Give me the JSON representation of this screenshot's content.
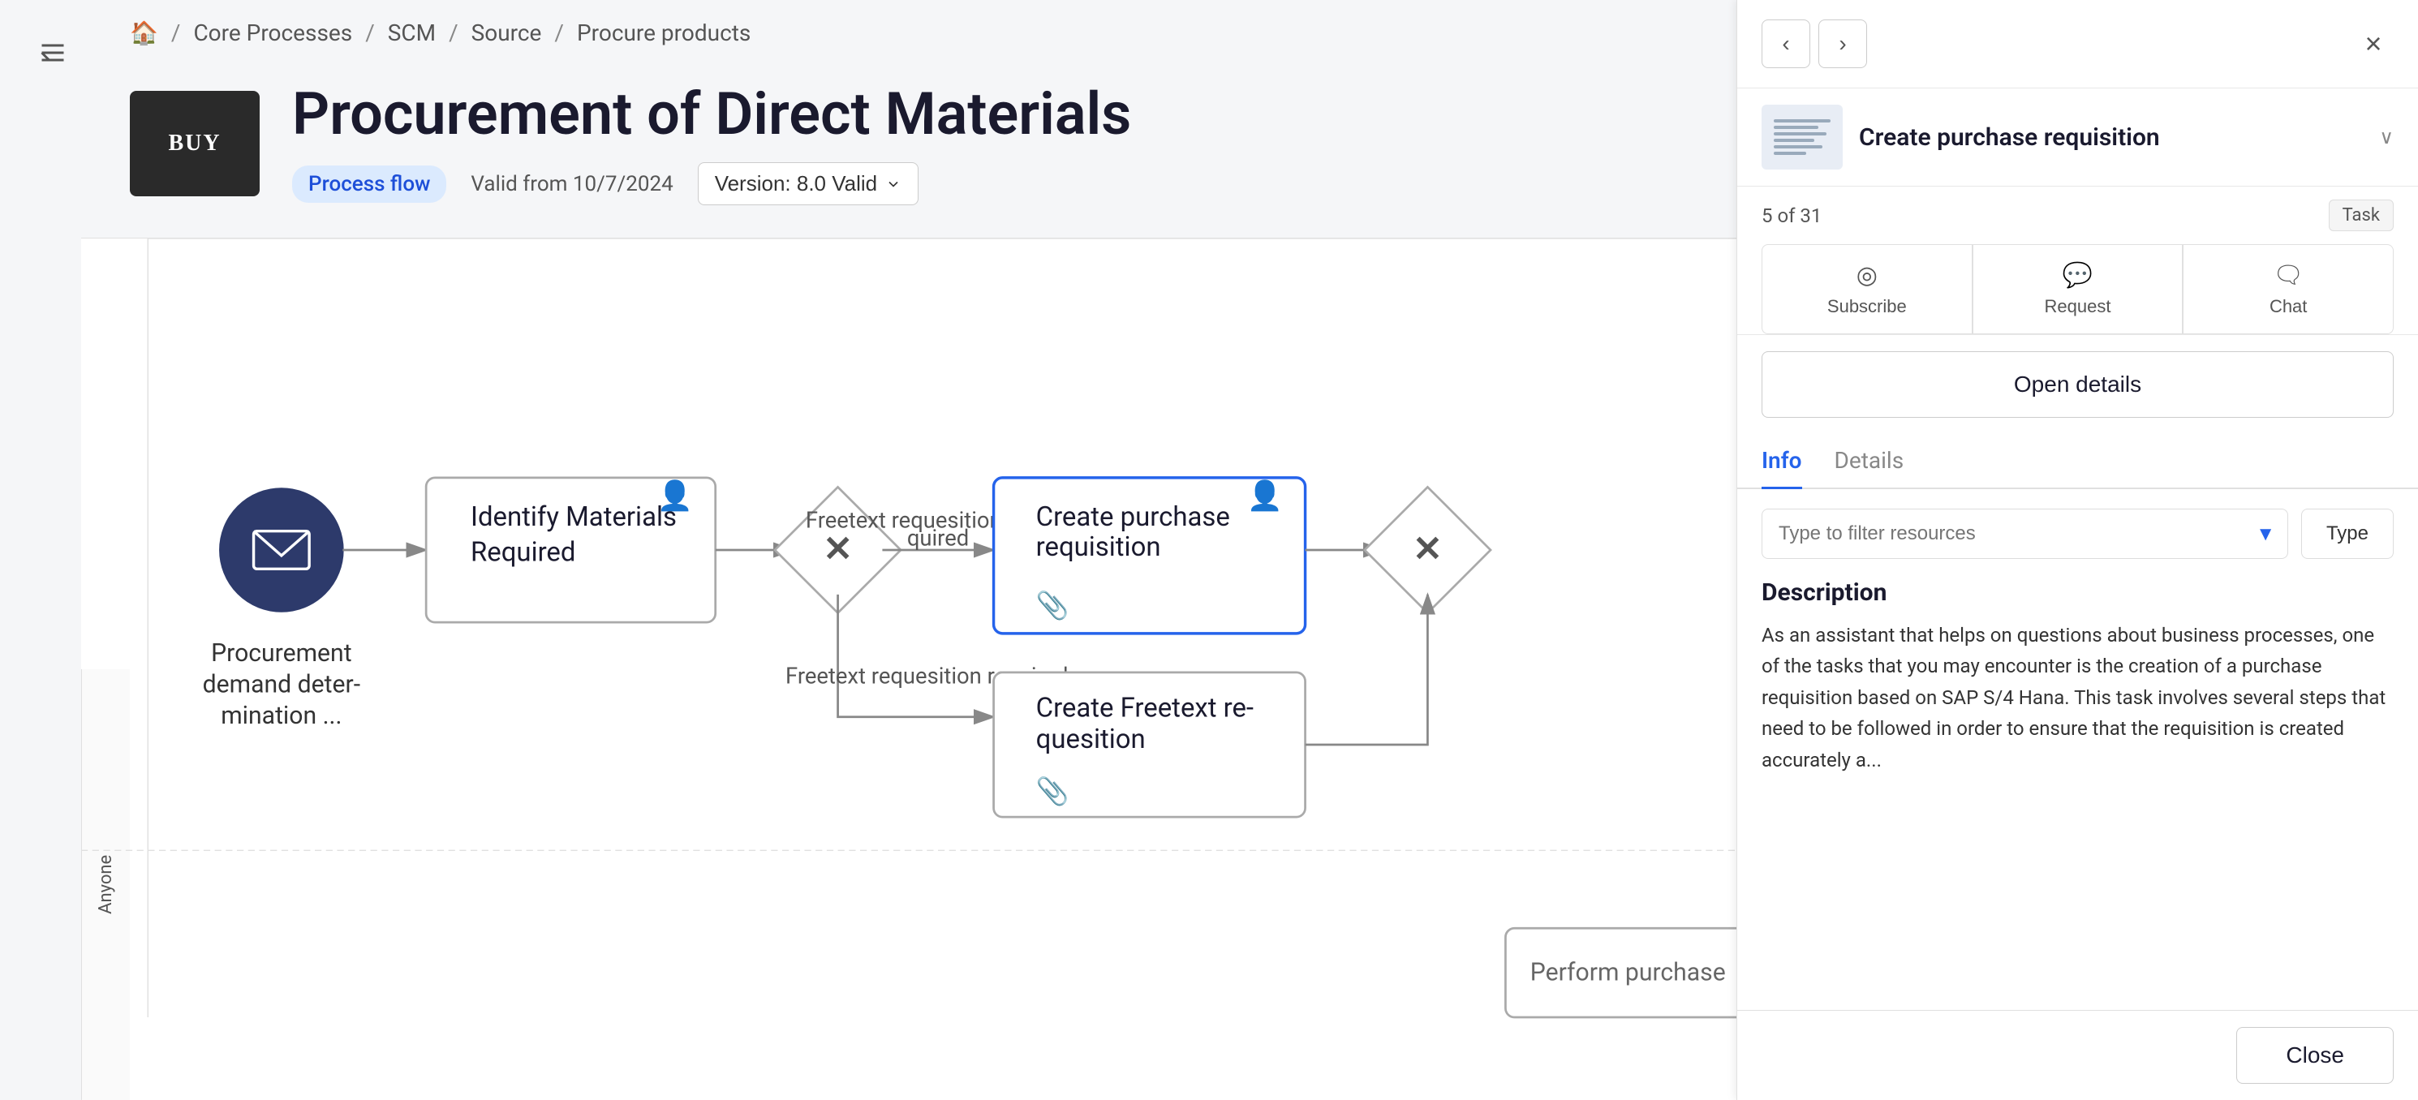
{
  "sidebar": {
    "toggle_icon": "≡"
  },
  "breadcrumb": {
    "home_icon": "⌂",
    "items": [
      "Core Processes",
      "SCM",
      "Source",
      "Procure products"
    ]
  },
  "header": {
    "thumbnail_text": "BUY",
    "title": "Procurement of Direct Materials",
    "badge": "Process flow",
    "valid_date": "Valid from 10/7/2024",
    "version": "Version: 8.0 Valid"
  },
  "flow": {
    "lane_label": "Anyone",
    "nodes": [
      {
        "id": "start",
        "type": "event",
        "label": "Procurement demand deter- mination ...",
        "icon": "✉"
      },
      {
        "id": "task1",
        "type": "task",
        "label": "Identify Materials Required",
        "user_icon": "👤"
      },
      {
        "id": "gateway1",
        "type": "gateway",
        "symbol": "✕"
      },
      {
        "id": "task2",
        "type": "task",
        "label": "Create purchase requisition",
        "user_icon": "👤",
        "selected": true
      },
      {
        "id": "gateway2",
        "type": "gateway",
        "symbol": "✕"
      },
      {
        "id": "task3",
        "type": "task",
        "label": "Create Freetext re- quesition"
      }
    ],
    "sequences": [
      {
        "label": "Freetext requesition not re- quired"
      },
      {
        "label": "Freetext requesition required"
      }
    ]
  },
  "right_panel": {
    "prev_icon": "‹",
    "next_icon": "›",
    "close_icon": "×",
    "card": {
      "title": "Create purchase requisition",
      "chevron": "∨"
    },
    "counter": "5 of 31",
    "task_badge": "Task",
    "actions": [
      {
        "label": "Subscribe",
        "icon": "👁"
      },
      {
        "label": "Request",
        "icon": "💬"
      },
      {
        "label": "Chat",
        "icon": "💬"
      }
    ],
    "open_details_label": "Open details",
    "tabs": [
      {
        "label": "Info",
        "active": true
      },
      {
        "label": "Details",
        "active": false
      }
    ],
    "filter_placeholder": "Type to filter resources",
    "type_btn": "Type",
    "description_title": "Description",
    "description_text": "As an assistant that helps on questions about business processes, one of the tasks that you may encounter is the creation of a purchase requisition based on SAP S/4 Hana. This task involves several steps that need to be followed in order to ensure that the requisition is created accurately a...",
    "close_btn": "Close"
  }
}
